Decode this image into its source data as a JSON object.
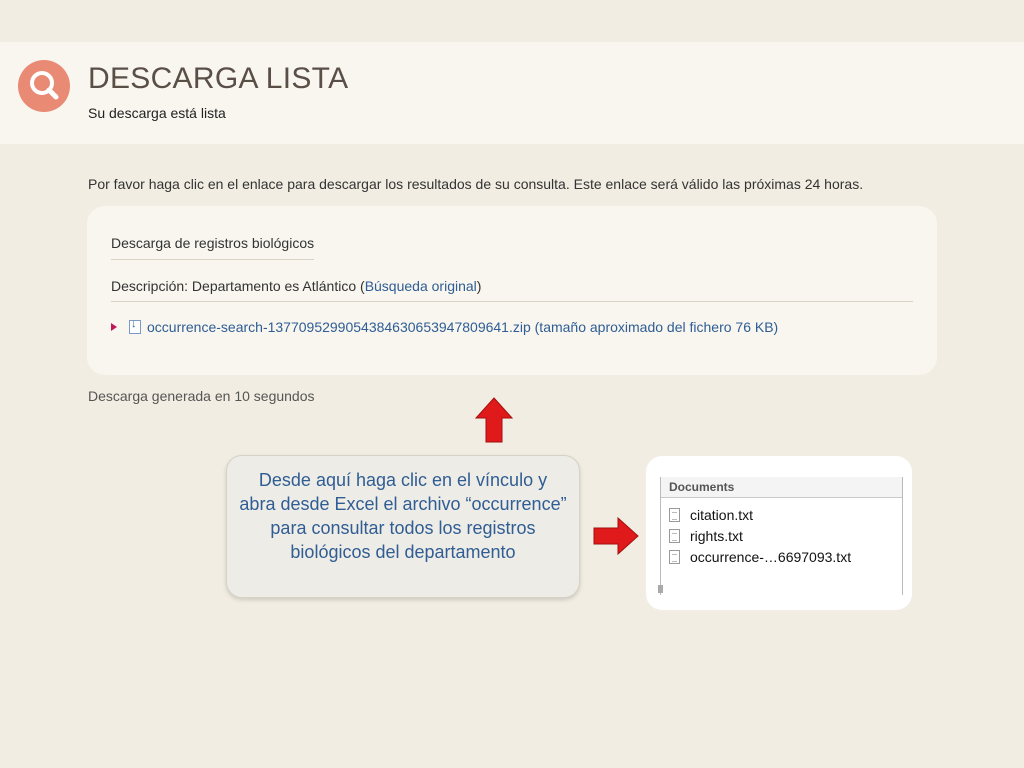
{
  "header": {
    "title": "DESCARGA LISTA",
    "subtitle": "Su descarga está lista"
  },
  "instructions": "Por favor haga clic en el enlace para descargar los resultados de su consulta. Este enlace será válido las próximas 24 horas.",
  "panel": {
    "title": "Descarga de registros biológicos",
    "description_prefix": "Descripción: Departamento es Atlántico (",
    "original_search_link": "Búsqueda original",
    "description_suffix": ")",
    "file_link": "occurrence-search-1377095299054384630653947809641.zip (tamaño aproximado del fichero 76 KB)"
  },
  "generated_text": "Descarga generada en 10 segundos",
  "callout": {
    "text": "Desde aquí haga clic en el vínculo y abra desde Excel el archivo “occurrence” para consultar todos los registros biológicos del departamento"
  },
  "finder": {
    "header": "Documents",
    "files": [
      "citation.txt",
      "rights.txt",
      "occurrence-…6697093.txt"
    ]
  },
  "colors": {
    "accent": "#e98a74",
    "link": "#2f5d94",
    "arrow": "#e01a1a"
  }
}
